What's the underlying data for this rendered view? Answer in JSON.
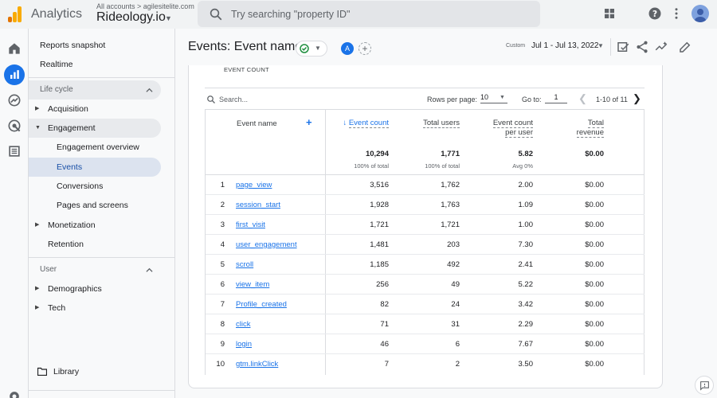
{
  "header": {
    "app_name": "Analytics",
    "account_crumb": "All accounts  >  agilesitelite.com",
    "property_name": "Rideology.io",
    "search_placeholder": "Try searching \"property ID\""
  },
  "sidebar": {
    "items": [
      {
        "label": "Reports snapshot"
      },
      {
        "label": "Realtime"
      }
    ],
    "lifecycle": {
      "title": "Life cycle",
      "acquisition": "Acquisition",
      "engagement": "Engagement",
      "sub": [
        "Engagement overview",
        "Events",
        "Conversions",
        "Pages and screens"
      ],
      "monetization": "Monetization",
      "retention": "Retention"
    },
    "user": {
      "title": "User",
      "demographics": "Demographics",
      "tech": "Tech"
    },
    "library": "Library"
  },
  "page": {
    "title": "Events: Event name",
    "compare_avatar": "A",
    "custom_label": "Custom",
    "date_range": "Jul 1 - Jul 13, 2022"
  },
  "card": {
    "label": "EVENT COUNT",
    "search_placeholder": "Search...",
    "rows_per_page_label": "Rows per page:",
    "rows_per_page": "10",
    "goto_label": "Go to:",
    "goto_value": "1",
    "page_range": "1-10 of 11"
  },
  "table": {
    "dimension_header": "Event name",
    "headers": {
      "event_count": "Event count",
      "total_users": "Total users",
      "per_user_1": "Event count",
      "per_user_2": "per user",
      "revenue_1": "Total",
      "revenue_2": "revenue"
    },
    "totals": {
      "event_count": "10,294",
      "event_count_sub": "100% of total",
      "total_users": "1,771",
      "total_users_sub": "100% of total",
      "per_user": "5.82",
      "per_user_sub": "Avg 0%",
      "revenue": "$0.00"
    },
    "rows": [
      {
        "idx": "1",
        "name": "page_view",
        "count": "3,516",
        "users": "1,762",
        "per_user": "2.00",
        "revenue": "$0.00"
      },
      {
        "idx": "2",
        "name": "session_start",
        "count": "1,928",
        "users": "1,763",
        "per_user": "1.09",
        "revenue": "$0.00"
      },
      {
        "idx": "3",
        "name": "first_visit",
        "count": "1,721",
        "users": "1,721",
        "per_user": "1.00",
        "revenue": "$0.00"
      },
      {
        "idx": "4",
        "name": "user_engagement",
        "count": "1,481",
        "users": "203",
        "per_user": "7.30",
        "revenue": "$0.00"
      },
      {
        "idx": "5",
        "name": "scroll",
        "count": "1,185",
        "users": "492",
        "per_user": "2.41",
        "revenue": "$0.00"
      },
      {
        "idx": "6",
        "name": "view_item",
        "count": "256",
        "users": "49",
        "per_user": "5.22",
        "revenue": "$0.00"
      },
      {
        "idx": "7",
        "name": "Profile_created",
        "count": "82",
        "users": "24",
        "per_user": "3.42",
        "revenue": "$0.00"
      },
      {
        "idx": "8",
        "name": "click",
        "count": "71",
        "users": "31",
        "per_user": "2.29",
        "revenue": "$0.00"
      },
      {
        "idx": "9",
        "name": "login",
        "count": "46",
        "users": "6",
        "per_user": "7.67",
        "revenue": "$0.00"
      },
      {
        "idx": "10",
        "name": "gtm.linkClick",
        "count": "7",
        "users": "2",
        "per_user": "3.50",
        "revenue": "$0.00"
      }
    ]
  },
  "colors": {
    "accent": "#1a73e8",
    "selected_bg": "#dce3ef",
    "logo_orange": "#f9ab00",
    "logo_dark_orange": "#e37400"
  }
}
